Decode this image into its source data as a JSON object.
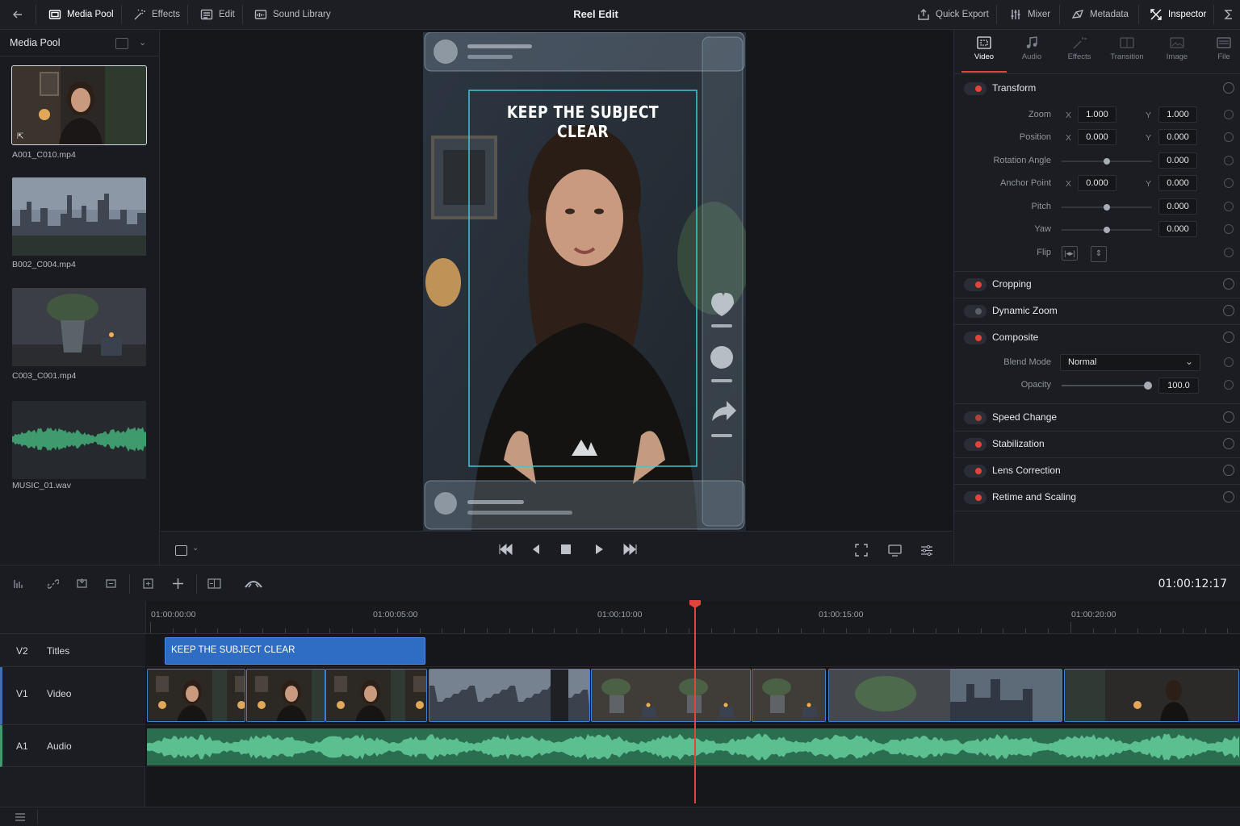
{
  "app": {
    "title": "Reel Edit"
  },
  "topbar": {
    "left": [
      {
        "label": "Media Pool",
        "icon": "media-pool-icon"
      },
      {
        "label": "Effects",
        "icon": "magic-wand-icon"
      },
      {
        "label": "Edit",
        "icon": "edit-list-icon"
      },
      {
        "label": "Sound Library",
        "icon": "sound-library-icon"
      }
    ],
    "right": [
      {
        "label": "Quick Export",
        "icon": "export-icon"
      },
      {
        "label": "Mixer",
        "icon": "mixer-icon"
      },
      {
        "label": "Metadata",
        "icon": "metadata-icon"
      },
      {
        "label": "Inspector",
        "icon": "inspector-icon"
      }
    ]
  },
  "media_pool": {
    "title": "Media Pool",
    "items": [
      {
        "name": "A001_C010.mp4",
        "kind": "video-portrait"
      },
      {
        "name": "B002_C004.mp4",
        "kind": "video-city"
      },
      {
        "name": "C003_C001.mp4",
        "kind": "video-plant"
      },
      {
        "name": "MUSIC_01.wav",
        "kind": "audio"
      }
    ]
  },
  "viewer": {
    "overlay_title": "KEEP THE SUBJECT CLEAR"
  },
  "inspector": {
    "tabs": [
      "Video",
      "Audio",
      "Effects",
      "Transition",
      "Image",
      "File"
    ],
    "active_tab": "Video",
    "transform": {
      "title": "Transform",
      "zoom_label": "Zoom",
      "zoom_x": "1.000",
      "zoom_y": "1.000",
      "position_label": "Position",
      "position_x": "0.000",
      "position_y": "0.000",
      "rotation_label": "Rotation Angle",
      "rotation": "0.000",
      "anchor_label": "Anchor Point",
      "anchor_x": "0.000",
      "anchor_y": "0.000",
      "pitch_label": "Pitch",
      "pitch": "0.000",
      "yaw_label": "Yaw",
      "yaw": "0.000",
      "flip_label": "Flip",
      "x_label": "X",
      "y_label": "Y"
    },
    "sections": {
      "cropping": "Cropping",
      "dynamic_zoom": "Dynamic Zoom",
      "composite": "Composite",
      "speed_change": "Speed Change",
      "stabilization": "Stabilization",
      "lens_correction": "Lens Correction",
      "retime": "Retime and Scaling"
    },
    "composite": {
      "blend_label": "Blend Mode",
      "blend_value": "Normal",
      "opacity_label": "Opacity",
      "opacity": "100.0"
    }
  },
  "timeline": {
    "timecode": "01:00:12:17",
    "ruler": [
      "01:00:00:00",
      "01:00:05:00",
      "01:00:10:00",
      "01:00:15:00",
      "01:00:20:00"
    ],
    "tracks": [
      {
        "id": "V2",
        "name": "Titles"
      },
      {
        "id": "V1",
        "name": "Video"
      },
      {
        "id": "A1",
        "name": "Audio"
      }
    ],
    "title_clip": "KEEP THE SUBJECT CLEAR"
  },
  "colors": {
    "accent": "#3f7fd0",
    "playhead": "#e0443a",
    "audio": "#3f9a6e",
    "enabled_dot": "#e0443a"
  }
}
